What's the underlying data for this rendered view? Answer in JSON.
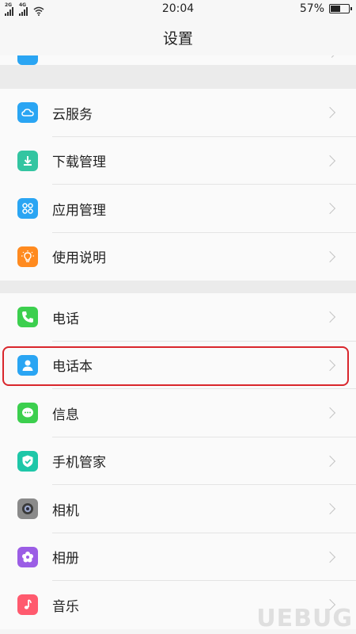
{
  "status_bar": {
    "network1": "2G",
    "network2": "4G",
    "time": "20:04",
    "battery": "57%",
    "battery_level": 0.57
  },
  "header": {
    "title": "设置"
  },
  "group1": {
    "items": [
      {
        "label": "云服务",
        "icon": "cloud-icon",
        "color": "#2aa5f3"
      },
      {
        "label": "下载管理",
        "icon": "download-icon",
        "color": "#33c5a1"
      },
      {
        "label": "应用管理",
        "icon": "apps-icon",
        "color": "#2aa5f3"
      },
      {
        "label": "使用说明",
        "icon": "lightbulb-icon",
        "color": "#ff8a1f"
      }
    ]
  },
  "group2": {
    "items": [
      {
        "label": "电话",
        "icon": "phone-icon",
        "color": "#3ccf4e"
      },
      {
        "label": "电话本",
        "icon": "contacts-icon",
        "color": "#2aa5f3"
      },
      {
        "label": "信息",
        "icon": "message-icon",
        "color": "#3ccf4e"
      },
      {
        "label": "手机管家",
        "icon": "shield-icon",
        "color": "#1ec7a8"
      },
      {
        "label": "相机",
        "icon": "camera-icon",
        "color": "#8a8a8a"
      },
      {
        "label": "相册",
        "icon": "photos-icon",
        "color": "#9b5de5"
      },
      {
        "label": "音乐",
        "icon": "music-icon",
        "color": "#ff5a6e"
      }
    ]
  },
  "watermark": "UEBUG"
}
